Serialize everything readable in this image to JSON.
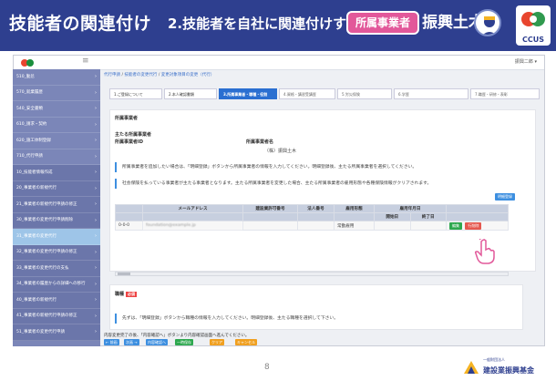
{
  "slide": {
    "title": "技能者の関連付け",
    "subtitle": "2.技能者を自社に関連付けする",
    "role_tag": "所属事業者",
    "company": "振興土木",
    "ccus": "CCUS",
    "page_number": "8",
    "foundation_small": "一般財団法人",
    "foundation": "建設業振興基金"
  },
  "app": {
    "user_menu": "振興二郎 ▾",
    "breadcrumb": [
      "代行申請",
      "技能者の変更代行",
      "変更対象項目の変更（代行）"
    ],
    "sidebar": [
      {
        "label": "510_勤怠",
        "state": "normal"
      },
      {
        "label": "570_就業履歴",
        "state": "normal"
      },
      {
        "label": "540_安全書類",
        "state": "normal"
      },
      {
        "label": "610_請求・契約",
        "state": "normal"
      },
      {
        "label": "620_施工体制登録",
        "state": "normal"
      },
      {
        "label": "710_代行申請",
        "state": "normal"
      },
      {
        "label": "10_技能者情報作成",
        "state": "sub"
      },
      {
        "label": "20_事業者の新規代行",
        "state": "sub"
      },
      {
        "label": "21_事業者の新規代行申請の修正",
        "state": "sub"
      },
      {
        "label": "30_事業者の変更代行申請削除",
        "state": "sub"
      },
      {
        "label": "31_事業者の変更代行",
        "state": "active"
      },
      {
        "label": "32_事業者の変更代行申請の修正",
        "state": "sub"
      },
      {
        "label": "33_事業者の変更代行の支払",
        "state": "sub"
      },
      {
        "label": "34_事業者の履歴からの詳細への移行",
        "state": "sub"
      },
      {
        "label": "40_事業者の新規代行",
        "state": "sub"
      },
      {
        "label": "41_事業者の新規代行申請の修正",
        "state": "sub"
      },
      {
        "label": "51_事業者の変更代行申請",
        "state": "sub"
      }
    ],
    "steps": [
      {
        "label": "1.ご登録について",
        "state": "done"
      },
      {
        "label": "2.本人確認書類",
        "state": "done"
      },
      {
        "label": "3.所属事業者・職種・役割",
        "state": "cur"
      },
      {
        "label": "4.資格・講習受講歴",
        "state": "todo"
      },
      {
        "label": "5.労災保険",
        "state": "todo"
      },
      {
        "label": "6.学歴",
        "state": "todo"
      },
      {
        "label": "7.職歴・研修・表彰",
        "state": "todo"
      }
    ],
    "affiliation": {
      "section_title": "所属事業者",
      "main_label": "主たる所属事業者",
      "id_label": "所属事業者ID",
      "name_label": "所属事業者名",
      "name_value": "（株）振興土木",
      "info1": "所属事業者を追加したい場合は、「明細登録」ボタンから所属事業者の情報を入力してください。明細登録後、主たる所属事業者を選択してください。",
      "info2": "社会保険を払っている事業者が主たる事業者となります。主たる所属事業者を変更した場合、主たる所属事業者の雇用形態や各種保険情報がクリアされます。",
      "add_button": "明細登録",
      "table": {
        "headers": [
          "",
          "メールアドレス",
          "建設業許可番号",
          "法人番号",
          "雇用形態",
          "雇用年月日",
          "",
          ""
        ],
        "subheaders": [
          "開始日",
          "終了日"
        ],
        "row": {
          "prefix": "0-0-0",
          "email": "foundation@example.jp",
          "employment": "常勤雇用",
          "edit": "編集",
          "delete": "行削除"
        }
      }
    },
    "occupation": {
      "section_title": "職種",
      "required": "必須",
      "info": "先ずは、「明細登録」ボタンから職種の情報を入力してください。明細登録後、主たる職種を選択して下さい。"
    },
    "footer": {
      "note": "内容変更完了の後、「内容確認へ」ボタンより内容確認画面へ進んでください。",
      "buttons": [
        "← 前画",
        "次画 →",
        "内容確認へ",
        "一時保存",
        "クリア",
        "キャンセル"
      ]
    }
  }
}
